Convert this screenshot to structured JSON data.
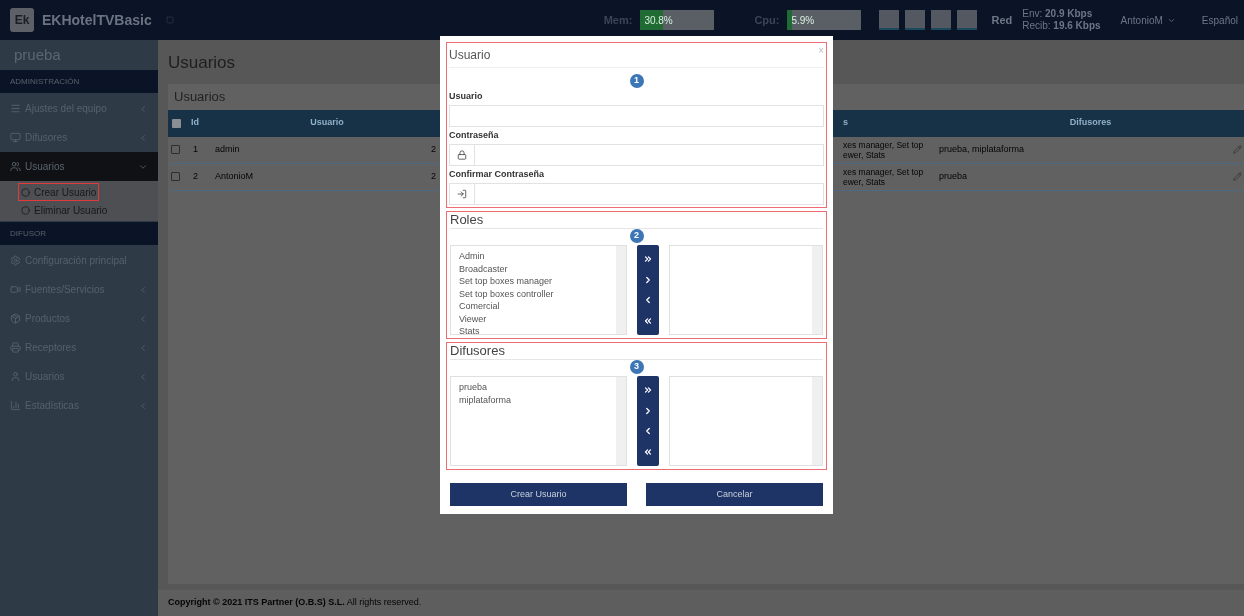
{
  "app": {
    "logo": "Ek",
    "name": "EKHotelTVBasic"
  },
  "header": {
    "meters": [
      {
        "label": "Mem:",
        "reading": "30.8%",
        "level": 0.308
      },
      {
        "label": "Cpu:",
        "reading": "5.9%",
        "level": 0.059
      }
    ],
    "network_label": "Red",
    "sent": "Env: **20.9 Kbps**",
    "received": "Recib: **19.6 Kbps**",
    "user": "AntonioM",
    "language": "Español"
  },
  "sidebar": {
    "title": "prueba",
    "sections": [
      {
        "heading": "ADMINISTRACIÓN",
        "items": [
          {
            "label": "Ajustes del equipo",
            "expanded": false,
            "has_caret": true
          },
          {
            "label": "Difusores",
            "expanded": false,
            "has_caret": true
          },
          {
            "label": "Usuarios",
            "expanded": true,
            "has_caret": true,
            "children": [
              {
                "label": "Crear Usuario",
                "highlighted": true
              },
              {
                "label": "Eliminar Usuario",
                "highlighted": false
              }
            ]
          }
        ]
      },
      {
        "heading": "DIFUSOR",
        "items": [
          {
            "label": "Configuración principal",
            "expanded": false,
            "has_caret": false
          },
          {
            "label": "Fuentes/Servicios",
            "expanded": false,
            "has_caret": true
          },
          {
            "label": "Productos",
            "expanded": false,
            "has_caret": true
          },
          {
            "label": "Receptores",
            "expanded": false,
            "has_caret": true
          },
          {
            "label": "Usuarios",
            "expanded": false,
            "has_caret": true
          },
          {
            "label": "Estadísticas",
            "expanded": false,
            "has_caret": true
          }
        ]
      }
    ]
  },
  "page": {
    "title": "Usuarios",
    "card_title": "Usuarios",
    "table": {
      "select_all_checked": false,
      "columns": [
        "Id",
        "Usuario",
        "s",
        "Difusores"
      ],
      "rows": [
        {
          "checked": false,
          "id": "1",
          "user": "admin",
          "column_4": "2",
          "column_5": "xes manager, Set top ewer, Stats",
          "broadcasters": "prueba, miplataforma"
        },
        {
          "checked": false,
          "id": "2",
          "user": "AntonioM",
          "column_4": "2",
          "column_5": "xes manager, Set top ewer, Stats",
          "broadcasters": "prueba"
        }
      ]
    }
  },
  "footer": "**Copyright © 2021 ITS Partner (O.B.S) S.L.** All rights reserved.",
  "modal": {
    "title": "Usuario",
    "close": "×",
    "fields": [
      {
        "number": "1",
        "label": "Usuario",
        "kind": "text"
      },
      {
        "label": "Contraseña",
        "kind": "password"
      },
      {
        "label": "Confirmar Contraseña",
        "kind": "confirm"
      }
    ],
    "pickers": [
      {
        "title": "Roles",
        "number": "2",
        "options": [
          "Admin",
          "Broadcaster",
          "Set top boxes manager",
          "Set top boxes controller",
          "Comercial",
          "Viewer",
          "Stats"
        ]
      },
      {
        "title": "Difusores",
        "number": "3",
        "options": [
          "prueba",
          "miplataforma"
        ]
      }
    ],
    "buttons": [
      "Crear Usuario",
      "Cancelar"
    ]
  }
}
